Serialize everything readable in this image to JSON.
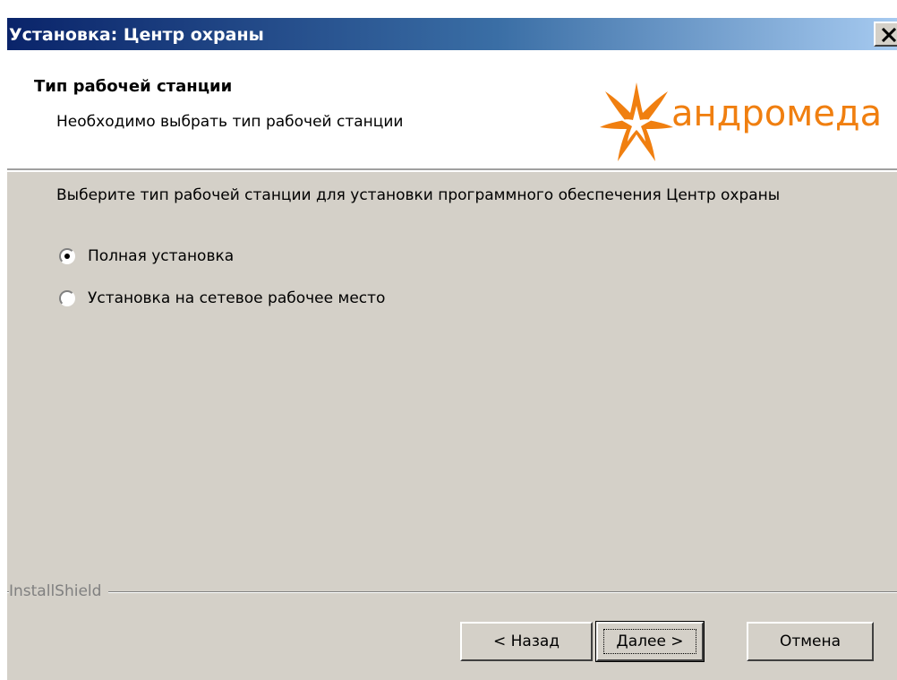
{
  "window": {
    "title": "Установка: Центр охраны",
    "close_label": "close"
  },
  "header": {
    "title": "Тип рабочей станции",
    "subtitle": "Необходимо выбрать тип рабочей станции",
    "logo_text": "андромеда",
    "logo_color": "#f07f10"
  },
  "main": {
    "instruction": "Выберите тип рабочей станции для установки программного обеспечения Центр охраны",
    "options": [
      {
        "label": "Полная установка",
        "selected": true
      },
      {
        "label": "Установка на сетевое рабочее место",
        "selected": false
      }
    ]
  },
  "footer": {
    "brand": "InstallShield",
    "back_label": "< Назад",
    "next_label": "Далее >",
    "cancel_label": "Отмена"
  },
  "colors": {
    "dialog_face": "#d4d0c8",
    "title_gradient_start": "#0a246a",
    "title_gradient_end": "#a6caf0"
  }
}
